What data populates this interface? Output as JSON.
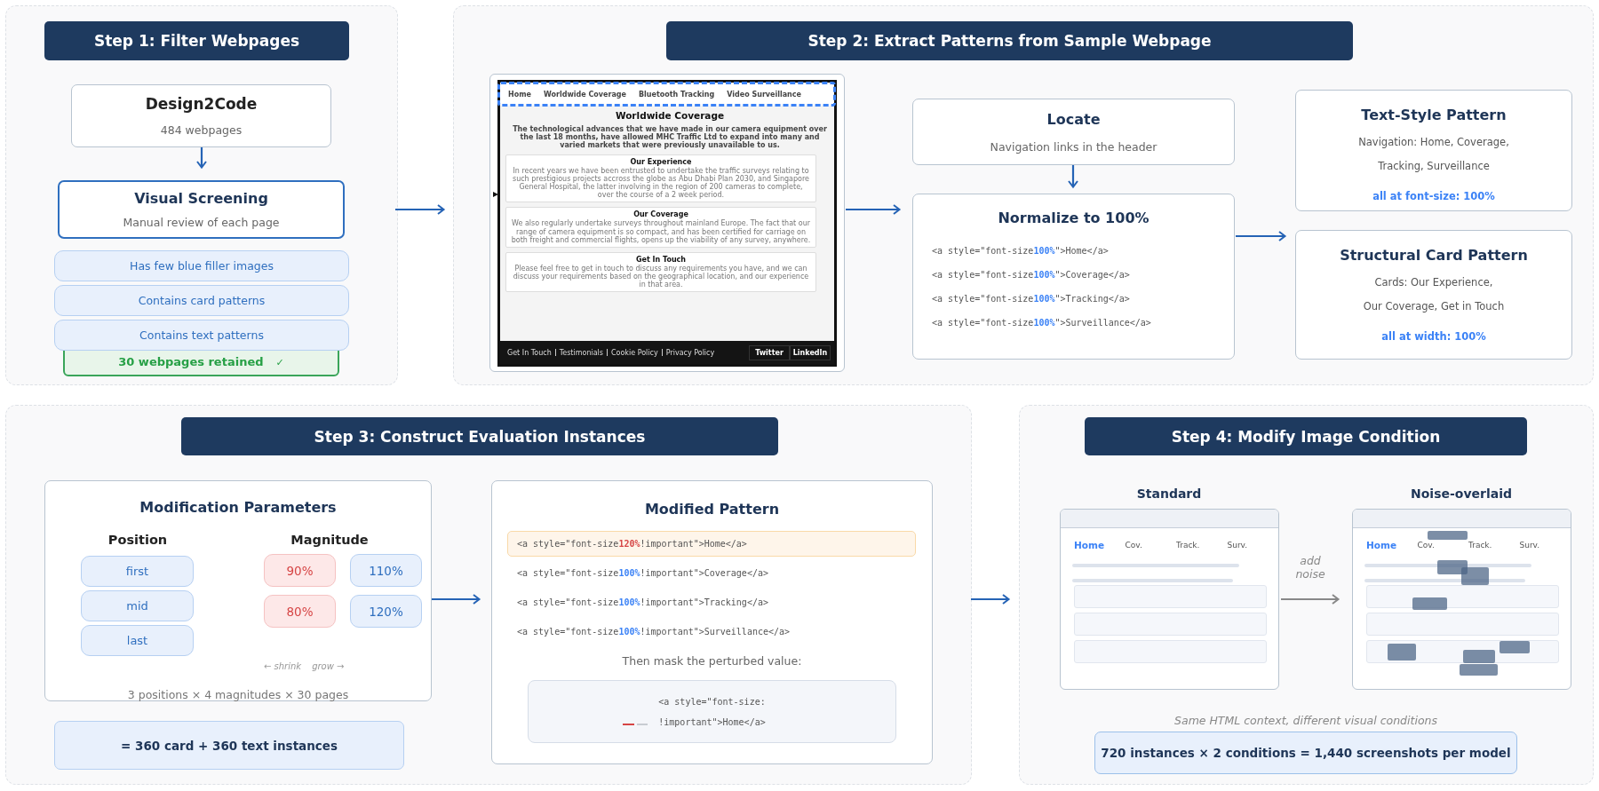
{
  "step1": {
    "header": "Step 1: Filter Webpages",
    "source": {
      "title": "Design2Code",
      "subtitle": "484 webpages"
    },
    "screening": {
      "title": "Visual Screening",
      "subtitle": "Manual review of each page"
    },
    "criteria": [
      "Has few blue filler images",
      "Contains card patterns",
      "Contains text patterns"
    ],
    "result": {
      "label": "30 webpages retained",
      "mark": "✓"
    }
  },
  "step2": {
    "header": "Step 2: Extract Patterns from Sample Webpage",
    "sample_page": {
      "nav": [
        "Home",
        "Worldwide Coverage",
        "Bluetooth Tracking",
        "Video Surveillance"
      ],
      "heading": "Worldwide Coverage",
      "intro": "The technological advances that we have made in our camera equipment over the last 18 months, have allowed MHC Traffic Ltd to expand into many and varied markets that were previously unavailable to us.",
      "cards": [
        {
          "title": "Our Experience",
          "text": "In recent years we have been entrusted to undertake the traffic surveys relating to such prestigious projects accross the globe as Abu Dhabi Plan 2030, and Singapore General Hospital, the latter involving in the region of 200 cameras to complete, over the course of a 2 week period."
        },
        {
          "title": "Our Coverage",
          "text": "We also regularly undertake surveys throughout mainland Europe. The fact that our range of camera equipment is so compact, and has been certified for carriage on both freight and commercial flights, opens up the viability of any survey, anywhere."
        },
        {
          "title": "Get In Touch",
          "text": "Please feel free to get in touch to discuss any requirements you have, and we can discuss your requirements based on the geographical location, and our experience in that area."
        }
      ],
      "footer_links": [
        "Get In Touch",
        "Testimonials",
        "Cookie Policy",
        "Privacy Policy"
      ],
      "footer_buttons": [
        "Twitter",
        "LinkedIn"
      ]
    },
    "locate": {
      "title": "Locate",
      "subtitle": "Navigation links in the header"
    },
    "normalize": {
      "title": "Normalize to 100%",
      "code_lines": [
        {
          "prefix": "<a style=\"font-size",
          "value": "100%",
          "suffix": "\">Home</a>"
        },
        {
          "prefix": "<a style=\"font-size",
          "value": "100%",
          "suffix": "\">Coverage</a>"
        },
        {
          "prefix": "<a style=\"font-size",
          "value": "100%",
          "suffix": "\">Tracking</a>"
        },
        {
          "prefix": "<a style=\"font-size",
          "value": "100%",
          "suffix": "\">Surveillance</a>"
        }
      ]
    },
    "patterns": [
      {
        "title": "Text-Style Pattern",
        "lines": [
          "Navigation: Home, Coverage,",
          "Tracking, Surveillance"
        ],
        "note": "all at font-size: 100%"
      },
      {
        "title": "Structural Card Pattern",
        "lines": [
          "Cards: Our Experience,",
          "Our Coverage, Get in Touch"
        ],
        "note": "all at width: 100%"
      }
    ]
  },
  "step3": {
    "header": "Step 3: Construct Evaluation Instances",
    "parameters": {
      "title": "Modification Parameters",
      "position_label": "Position",
      "positions": [
        "first",
        "mid",
        "last"
      ],
      "magnitude_label": "Magnitude",
      "magnitudes": [
        {
          "label": "90%",
          "kind": "shrink"
        },
        {
          "label": "110%",
          "kind": "grow"
        },
        {
          "label": "80%",
          "kind": "shrink"
        },
        {
          "label": "120%",
          "kind": "grow"
        }
      ],
      "legend": [
        "← shrink",
        "grow →"
      ],
      "formula": "3 positions × 4 magnitudes × 30 pages"
    },
    "total": "= 360 card + 360 text instances",
    "modified": {
      "title": "Modified Pattern",
      "code_lines": [
        {
          "prefix": "<a style=\"font-size",
          "value": "120%",
          "suffix": " !important\">Home</a>",
          "perturbed": true
        },
        {
          "prefix": "<a style=\"font-size",
          "value": "100%",
          "suffix": " !important\">Coverage</a>",
          "perturbed": false
        },
        {
          "prefix": "<a style=\"font-size",
          "value": "100%",
          "suffix": " !important\">Tracking</a>",
          "perturbed": false
        },
        {
          "prefix": "<a style=\"font-size",
          "value": "100%",
          "suffix": " !important\">Surveillance</a>",
          "perturbed": false
        }
      ],
      "mask_caption": "Then mask the perturbed value:",
      "masked_lines": [
        "<a style=\"font-size:",
        "!important\">Home</a>"
      ]
    }
  },
  "step4": {
    "header": "Step 4: Modify Image Condition",
    "windows": [
      {
        "title": "Standard",
        "noise": false,
        "nav": [
          {
            "label": "Home",
            "selected": true
          },
          {
            "label": "Cov.",
            "selected": false
          },
          {
            "label": "Track.",
            "selected": false
          },
          {
            "label": "Surv.",
            "selected": false
          }
        ]
      },
      {
        "title": "Noise-overlaid",
        "noise": true,
        "nav": [
          {
            "label": "Home",
            "selected": true
          },
          {
            "label": "Cov.",
            "selected": false
          },
          {
            "label": "Track.",
            "selected": false
          },
          {
            "label": "Surv.",
            "selected": false
          }
        ]
      }
    ],
    "transition": "add noise",
    "caption": "Same HTML context, different visual conditions",
    "total": "720 instances × 2 conditions = 1,440 screenshots per model"
  }
}
